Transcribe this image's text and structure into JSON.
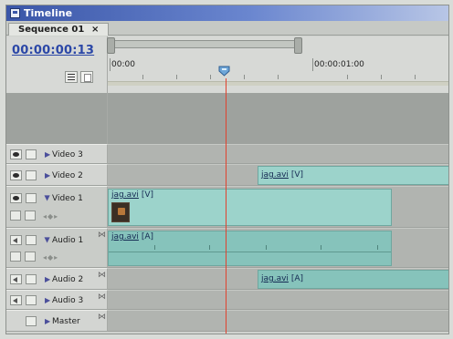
{
  "window": {
    "title": "Timeline"
  },
  "tab": {
    "label": "Sequence 01",
    "close": "×"
  },
  "header": {
    "timecode": "00:00:00:13",
    "ruler_start": "00:00",
    "ruler_end": "00:00:01:00"
  },
  "tracks": {
    "video3": {
      "name": "Video 3"
    },
    "video2": {
      "name": "Video 2",
      "clip": "jag.avi",
      "clip_suffix": "[V]"
    },
    "video1": {
      "name": "Video 1",
      "clip": "jag.avi",
      "clip_suffix": "[V]"
    },
    "audio1": {
      "name": "Audio 1",
      "clip": "jag.avi",
      "clip_suffix": "[A]"
    },
    "audio2": {
      "name": "Audio 2",
      "clip": "jag.avi",
      "clip_suffix": "[A]"
    },
    "audio3": {
      "name": "Audio 3"
    },
    "master": {
      "name": "Master"
    }
  },
  "colors": {
    "clip": "#9cd3cb",
    "playhead": "#e0432f",
    "timecode": "#2b47a7",
    "title_bar": "#3a56a8"
  },
  "icons": [
    "window-icon",
    "eye-icon",
    "speaker-icon",
    "lock-box-icon",
    "expand-triangle-icon",
    "snap-icon",
    "marker-icon",
    "playhead-icon"
  ]
}
